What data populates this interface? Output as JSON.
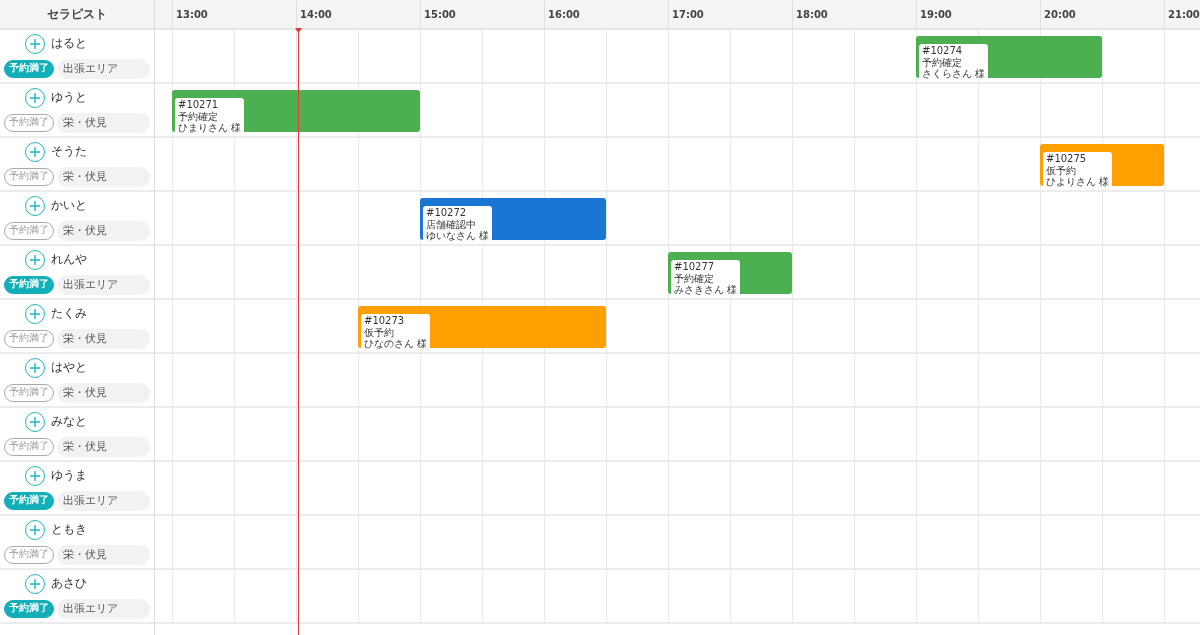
{
  "header": {
    "therapist_column": "セラピスト",
    "hours": [
      "13:00",
      "14:00",
      "15:00",
      "16:00",
      "17:00",
      "18:00",
      "19:00",
      "20:00",
      "21:00"
    ]
  },
  "therapists": [
    {
      "name": "はると",
      "badge": "予約満了",
      "full": true,
      "area": "出張エリア",
      "bookings": [
        {
          "id": "#10274",
          "status": "予約確定",
          "customer": "さくらさん 様",
          "color": "#4caf50"
        }
      ]
    },
    {
      "name": "ゆうと",
      "badge": "予約満了",
      "full": false,
      "area": "栄・伏見",
      "bookings": [
        {
          "id": "#10271",
          "status": "予約確定",
          "customer": "ひまりさん 様",
          "color": "#4caf50"
        }
      ]
    },
    {
      "name": "そうた",
      "badge": "予約満了",
      "full": false,
      "area": "栄・伏見",
      "bookings": [
        {
          "id": "#10275",
          "status": "仮予約",
          "customer": "ひよりさん 様",
          "color": "#ff9f00"
        }
      ]
    },
    {
      "name": "かいと",
      "badge": "予約満了",
      "full": false,
      "area": "栄・伏見",
      "bookings": [
        {
          "id": "#10272",
          "status": "店舗確認中",
          "customer": "ゆいなさん 様",
          "color": "#1976d2"
        }
      ]
    },
    {
      "name": "れんや",
      "badge": "予約満了",
      "full": true,
      "area": "出張エリア",
      "bookings": [
        {
          "id": "#10277",
          "status": "予約確定",
          "customer": "みさきさん 様",
          "color": "#4caf50"
        }
      ]
    },
    {
      "name": "たくみ",
      "badge": "予約満了",
      "full": false,
      "area": "栄・伏見",
      "bookings": [
        {
          "id": "#10273",
          "status": "仮予約",
          "customer": "ひなのさん 様",
          "color": "#ff9f00"
        }
      ]
    },
    {
      "name": "はやと",
      "badge": "予約満了",
      "full": false,
      "area": "栄・伏見"
    },
    {
      "name": "みなと",
      "badge": "予約満了",
      "full": false,
      "area": "栄・伏見"
    },
    {
      "name": "ゆうま",
      "badge": "予約満了",
      "full": true,
      "area": "出張エリア"
    },
    {
      "name": "ともき",
      "badge": "予約満了",
      "full": false,
      "area": "栄・伏見"
    },
    {
      "name": "あさひ",
      "badge": "予約満了",
      "full": true,
      "area": "出張エリア"
    }
  ]
}
